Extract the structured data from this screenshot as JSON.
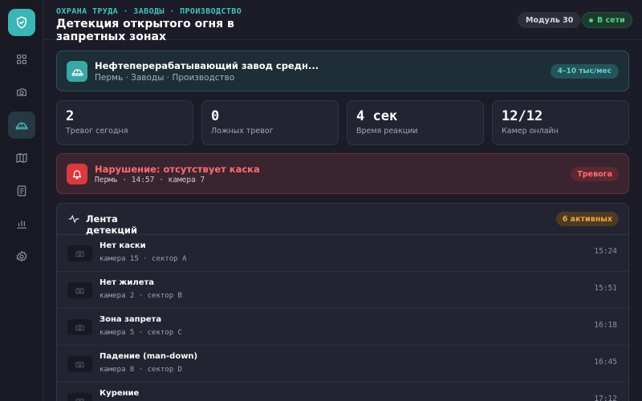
{
  "sidebar": {
    "items": [
      {
        "icon": "dashboard-icon"
      },
      {
        "icon": "camera-feed-icon"
      },
      {
        "icon": "hard-hat-icon",
        "active": true
      },
      {
        "icon": "map-icon"
      },
      {
        "icon": "document-icon"
      },
      {
        "icon": "bar-chart-icon"
      },
      {
        "icon": "settings-icon"
      }
    ]
  },
  "header": {
    "breadcrumb": "ОХРАНА ТРУДА · ЗАВОДЫ · ПРОИЗВОДСТВО",
    "title": "Детекция открытого огня в запретных зонах",
    "module_label": "Модуль 30",
    "status_label": "В сети"
  },
  "plant": {
    "name": "Нефтеперерабатывающий завод средн...",
    "meta": "Пермь · Заводы · Производство",
    "badge": "4–10 тыс/мес"
  },
  "stats": [
    {
      "value": "2",
      "label": "Тревог сегодня"
    },
    {
      "value": "0",
      "label": "Ложных тревог"
    },
    {
      "value": "4 сек",
      "label": "Время реакции"
    },
    {
      "value": "12/12",
      "label": "Камер онлайн"
    }
  ],
  "alert": {
    "title": "Нарушение: отсутствует каска",
    "meta": "Пермь · 14:57 · камера 7",
    "badge": "Тревога"
  },
  "feed": {
    "title": "Лента детекций",
    "badge": "6 активных",
    "rows": [
      {
        "title": "Нет каски",
        "meta": "камера 15 · сектор A",
        "time": "15:24"
      },
      {
        "title": "Нет жилета",
        "meta": "камера 2 · сектор B",
        "time": "15:51"
      },
      {
        "title": "Зона запрета",
        "meta": "камера 5 · сектор C",
        "time": "16:18"
      },
      {
        "title": "Падение (man-down)",
        "meta": "камера 8 · сектор D",
        "time": "16:45"
      },
      {
        "title": "Курение",
        "meta": "",
        "time": "17:12"
      }
    ]
  },
  "colors": {
    "accent": "#3bb5b5",
    "danger": "#d83a3d",
    "warning": "#f0a63a",
    "success": "#4fd08a"
  }
}
